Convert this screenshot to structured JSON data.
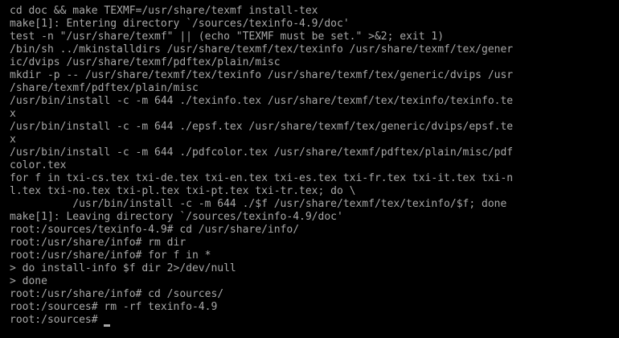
{
  "colors": {
    "background": "#000000",
    "foreground": "#a8a8a8"
  },
  "terminal": {
    "lines": [
      "cd doc && make TEXMF=/usr/share/texmf install-tex",
      "make[1]: Entering directory `/sources/texinfo-4.9/doc'",
      "test -n \"/usr/share/texmf\" || (echo \"TEXMF must be set.\" >&2; exit 1)",
      "/bin/sh ../mkinstalldirs /usr/share/texmf/tex/texinfo /usr/share/texmf/tex/gener",
      "ic/dvips /usr/share/texmf/pdftex/plain/misc",
      "mkdir -p -- /usr/share/texmf/tex/texinfo /usr/share/texmf/tex/generic/dvips /usr",
      "/share/texmf/pdftex/plain/misc",
      "/usr/bin/install -c -m 644 ./texinfo.tex /usr/share/texmf/tex/texinfo/texinfo.te",
      "x",
      "/usr/bin/install -c -m 644 ./epsf.tex /usr/share/texmf/tex/generic/dvips/epsf.te",
      "x",
      "/usr/bin/install -c -m 644 ./pdfcolor.tex /usr/share/texmf/pdftex/plain/misc/pdf",
      "color.tex",
      "for f in txi-cs.tex txi-de.tex txi-en.tex txi-es.tex txi-fr.tex txi-it.tex txi-n",
      "l.tex txi-no.tex txi-pl.tex txi-pt.tex txi-tr.tex; do \\",
      "          /usr/bin/install -c -m 644 ./$f /usr/share/texmf/tex/texinfo/$f; done",
      "make[1]: Leaving directory `/sources/texinfo-4.9/doc'",
      "root:/sources/texinfo-4.9# cd /usr/share/info/",
      "root:/usr/share/info# rm dir",
      "root:/usr/share/info# for f in *",
      "> do install-info $f dir 2>/dev/null",
      "> done",
      "root:/usr/share/info# cd /sources/",
      "root:/sources# rm -rf texinfo-4.9",
      "root:/sources# "
    ]
  }
}
